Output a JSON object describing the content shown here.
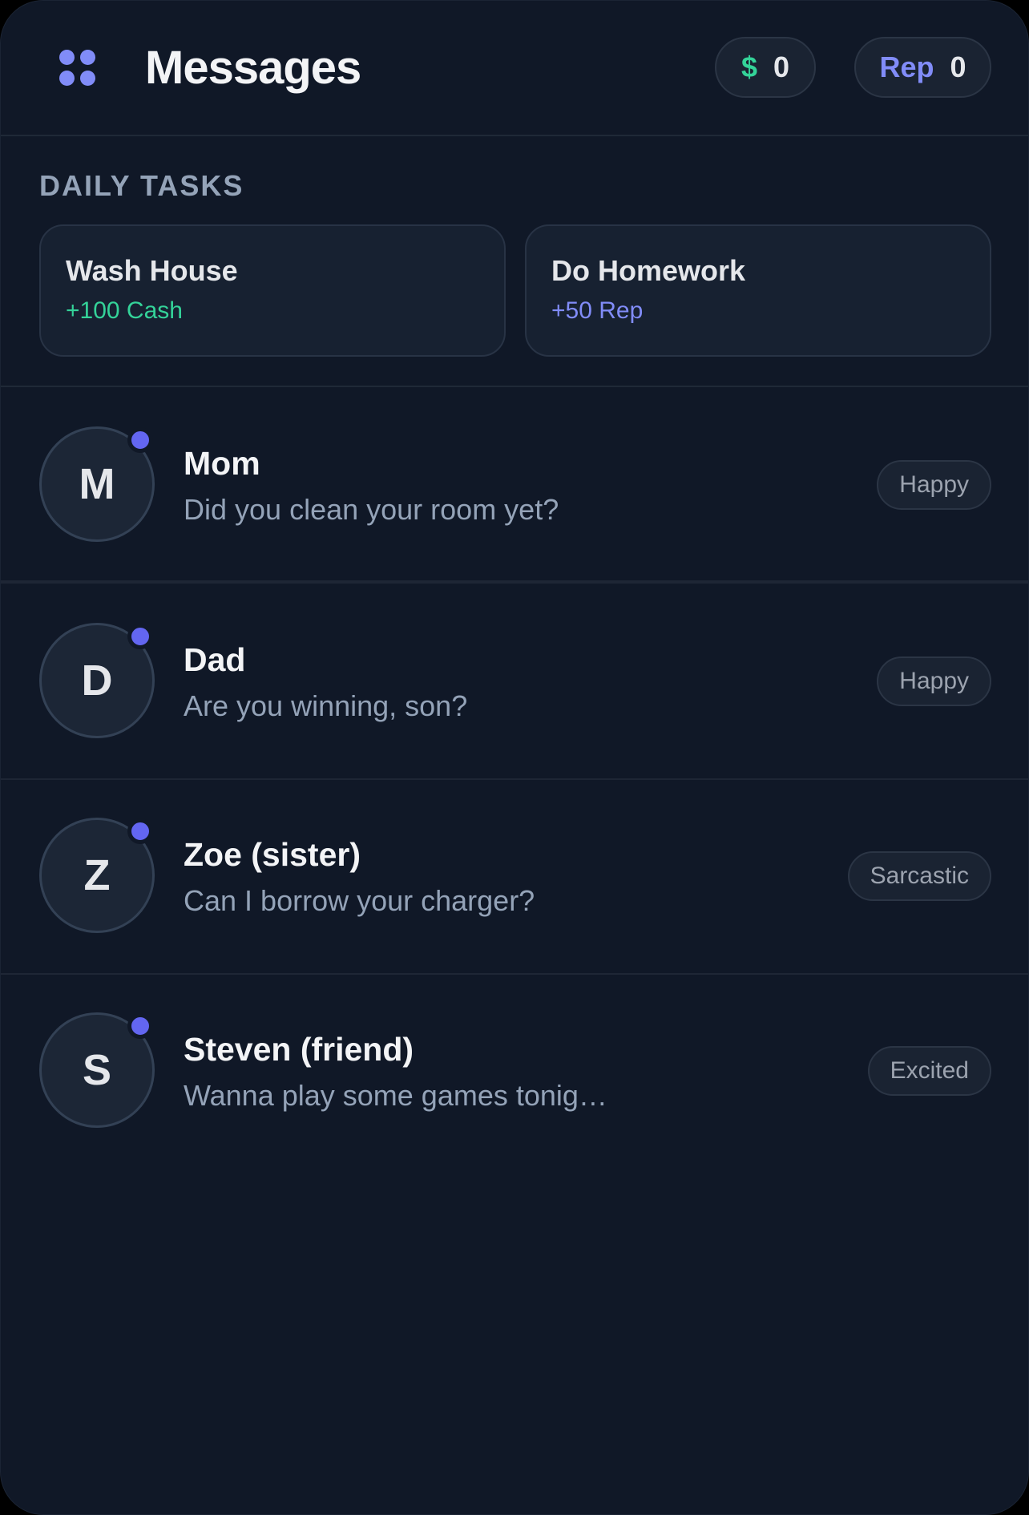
{
  "header": {
    "title": "Messages",
    "menu_icon": "grid-dots-icon",
    "cash": {
      "label": "$",
      "value": "0"
    },
    "rep": {
      "label": "Rep",
      "value": "0"
    }
  },
  "tasks": {
    "heading": "DAILY TASKS",
    "items": [
      {
        "name": "Wash House",
        "reward": "+100 Cash"
      },
      {
        "name": "Do Homework",
        "reward": "+50 Rep"
      }
    ]
  },
  "conversations": [
    {
      "initial": "M",
      "name": "Mom",
      "message": "Did you clean your room yet?",
      "mood": "Happy"
    },
    {
      "initial": "D",
      "name": "Dad",
      "message": "Are you winning, son?",
      "mood": "Happy"
    },
    {
      "initial": "Z",
      "name": "Zoe (sister)",
      "message": "Can I borrow your charger?",
      "mood": "Sarcastic"
    },
    {
      "initial": "S",
      "name": "Steven (friend)",
      "message": "Wanna play some games tonig…",
      "mood": "Excited"
    }
  ],
  "colors": {
    "background": "#101827",
    "accent": "#818cf8",
    "cash": "#34d399",
    "online": "#6366f1"
  }
}
